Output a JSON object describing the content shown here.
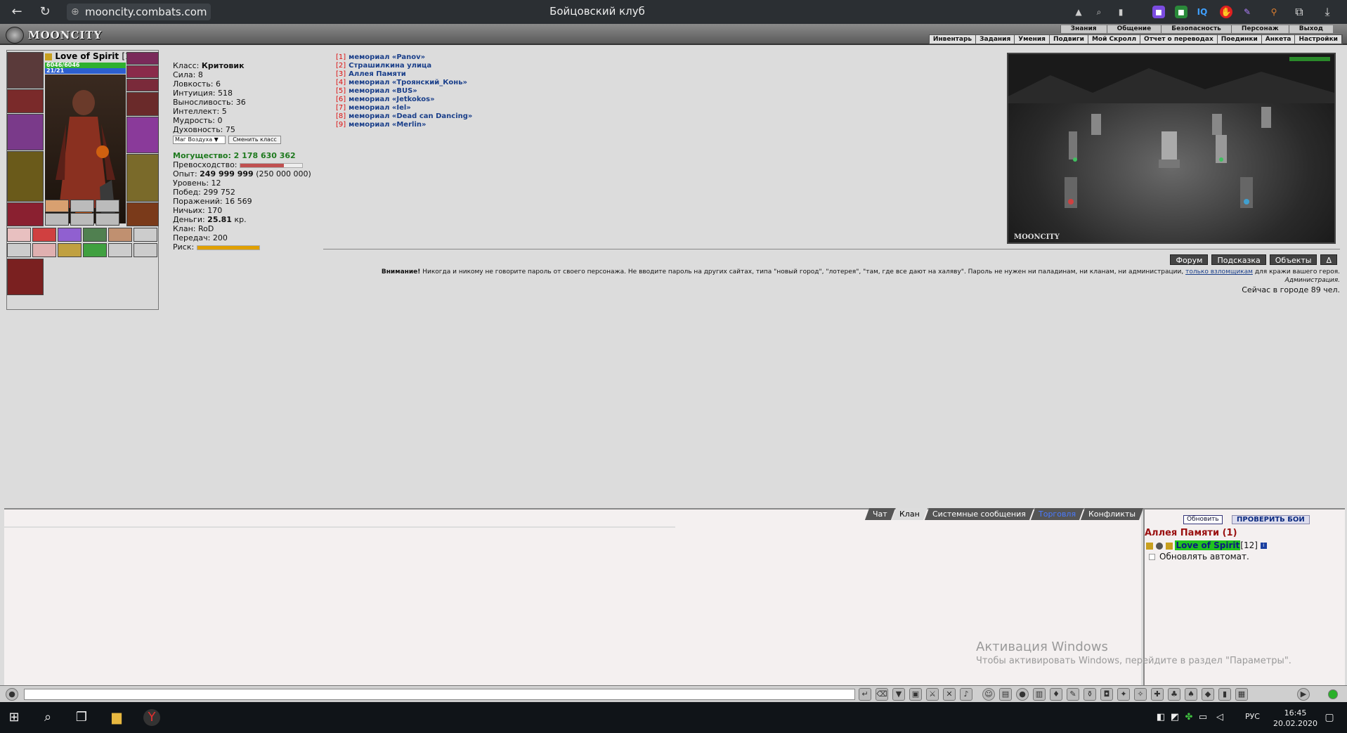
{
  "browser": {
    "url": "mooncity.combats.com",
    "tab_title": "Бойцовский клуб"
  },
  "header": {
    "logo": "MOONCITY",
    "top_menu": [
      "Знания",
      "Общение",
      "Безопасность",
      "Персонаж",
      "Выход"
    ],
    "sub_menu": [
      "Инвентарь",
      "Задания",
      "Умения",
      "Подвиги",
      "Мой Скролл",
      "Отчет о переводах",
      "Поединки",
      "Анкета",
      "Настройки"
    ]
  },
  "character": {
    "name": "Love of Spirit",
    "level": "[12]",
    "hp": "6046/6046",
    "mp": "21/21",
    "class_label": "Класс:",
    "class_value": "Критовик",
    "stats": [
      {
        "label": "Сила:",
        "value": "8"
      },
      {
        "label": "Ловкость:",
        "value": "6"
      },
      {
        "label": "Интуиция:",
        "value": "518"
      },
      {
        "label": "Выносливость:",
        "value": "36"
      },
      {
        "label": "Интеллект:",
        "value": "5"
      },
      {
        "label": "Мудрость:",
        "value": "0"
      },
      {
        "label": "Духовность:",
        "value": "75"
      }
    ],
    "class_select": "Маг Воздуха ▼",
    "change_class": "Сменить класс",
    "power": "Могущество: 2 178 630 362",
    "superiority_label": "Превосходство:",
    "superiority_fill": 0.7,
    "exp_label": "Опыт:",
    "exp_value": "249 999 999",
    "exp_next": "(250 000 000)",
    "level_label": "Уровень: 12",
    "wins": "Побед: 299 752",
    "losses": "Поражений: 16 569",
    "draws": "Ничьих: 170",
    "money_label": "Деньги:",
    "money_value": "25.81",
    "money_unit": "кр.",
    "clan": "Клан: RoD",
    "transfers": "Передач: 200",
    "risk_label": "Риск:",
    "risk_fill": 1.0
  },
  "locations": [
    {
      "num": "[1]",
      "name": "мемориал «Panov»"
    },
    {
      "num": "[2]",
      "name": "Страшилкина улица"
    },
    {
      "num": "[3]",
      "name": "Аллея Памяти"
    },
    {
      "num": "[4]",
      "name": "мемориал «Троянский_Конь»"
    },
    {
      "num": "[5]",
      "name": "мемориал «BUS»"
    },
    {
      "num": "[6]",
      "name": "мемориал «Jetkokos»"
    },
    {
      "num": "[7]",
      "name": "мемориал «Iel»"
    },
    {
      "num": "[8]",
      "name": "мемориал «Dead can Dancing»"
    },
    {
      "num": "[9]",
      "name": "мемориал «Merlin»"
    }
  ],
  "scene": {
    "label": "MOONCITY"
  },
  "right_buttons": [
    "Форум",
    "Подсказка",
    "Объекты",
    "Δ"
  ],
  "warning": {
    "bold": "Внимание!",
    "text": "Никогда и никому не говорите пароль от своего персонажа. Не вводите пароль на других сайтах, типа \"новый город\", \"лотерея\", \"там, где все дают на халяву\". Пароль не нужен ни паладинам, ни кланам, ни администрации,",
    "link": "только взломщикам",
    "tail": "для кражи вашего героя.",
    "signature": "Администрация.",
    "online": "Сейчас в городе 89 чел."
  },
  "chat": {
    "tabs": [
      "Чат",
      "Клан",
      "Системные сообщения",
      "Торговля",
      "Конфликты"
    ],
    "active_tab": "Клан"
  },
  "online_panel": {
    "refresh": "Обновить",
    "check_battles": "ПРОВЕРИТЬ БОИ",
    "location_title": "Аллея Памяти (1)",
    "player_name": "Love of Spirit",
    "player_level": "[12]",
    "auto_refresh": "Обновлять автомат."
  },
  "watermark": {
    "line1": "Активация Windows",
    "line2": "Чтобы активировать Windows, перейдите в раздел \"Параметры\"."
  },
  "taskbar": {
    "lang": "РУС",
    "time": "16:45",
    "date": "20.02.2020"
  }
}
